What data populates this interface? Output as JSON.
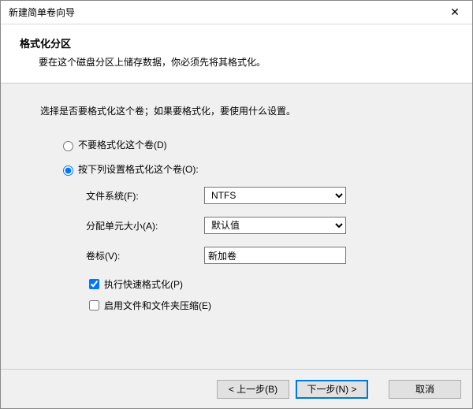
{
  "window": {
    "title": "新建简单卷向导"
  },
  "header": {
    "title": "格式化分区",
    "subtitle": "要在这个磁盘分区上储存数据，你必须先将其格式化。"
  },
  "instruction": "选择是否要格式化这个卷；如果要格式化，要使用什么设置。",
  "radios": {
    "no_format": "不要格式化这个卷(D)",
    "format_with": "按下列设置格式化这个卷(O):"
  },
  "form": {
    "fs_label": "文件系统(F):",
    "fs_value": "NTFS",
    "alloc_label": "分配单元大小(A):",
    "alloc_value": "默认值",
    "volname_label": "卷标(V):",
    "volname_value": "新加卷",
    "quick_format": "执行快速格式化(P)",
    "compression": "启用文件和文件夹压缩(E)"
  },
  "buttons": {
    "back": "< 上一步(B)",
    "next": "下一步(N) >",
    "cancel": "取消"
  }
}
